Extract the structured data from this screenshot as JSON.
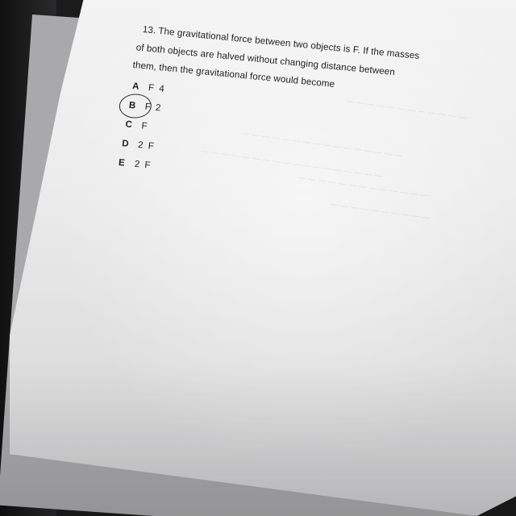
{
  "question": {
    "line1": "13. The gravitational force between two objects is F. If the masses",
    "line2": "of both objects are halved without changing distance between",
    "line3": "them, then the gravitational force would become"
  },
  "options": [
    {
      "letter": "A",
      "text": "F 4",
      "circled": false
    },
    {
      "letter": "B",
      "text": "F 2",
      "circled": true
    },
    {
      "letter": "C",
      "text": "F",
      "circled": false
    },
    {
      "letter": "D",
      "text": "2 F",
      "circled": false
    },
    {
      "letter": "E",
      "text": "2 F",
      "circled": false
    }
  ],
  "colors": {
    "background": "#1b1b1c",
    "paper": "#ececec",
    "ink": "#202022"
  }
}
